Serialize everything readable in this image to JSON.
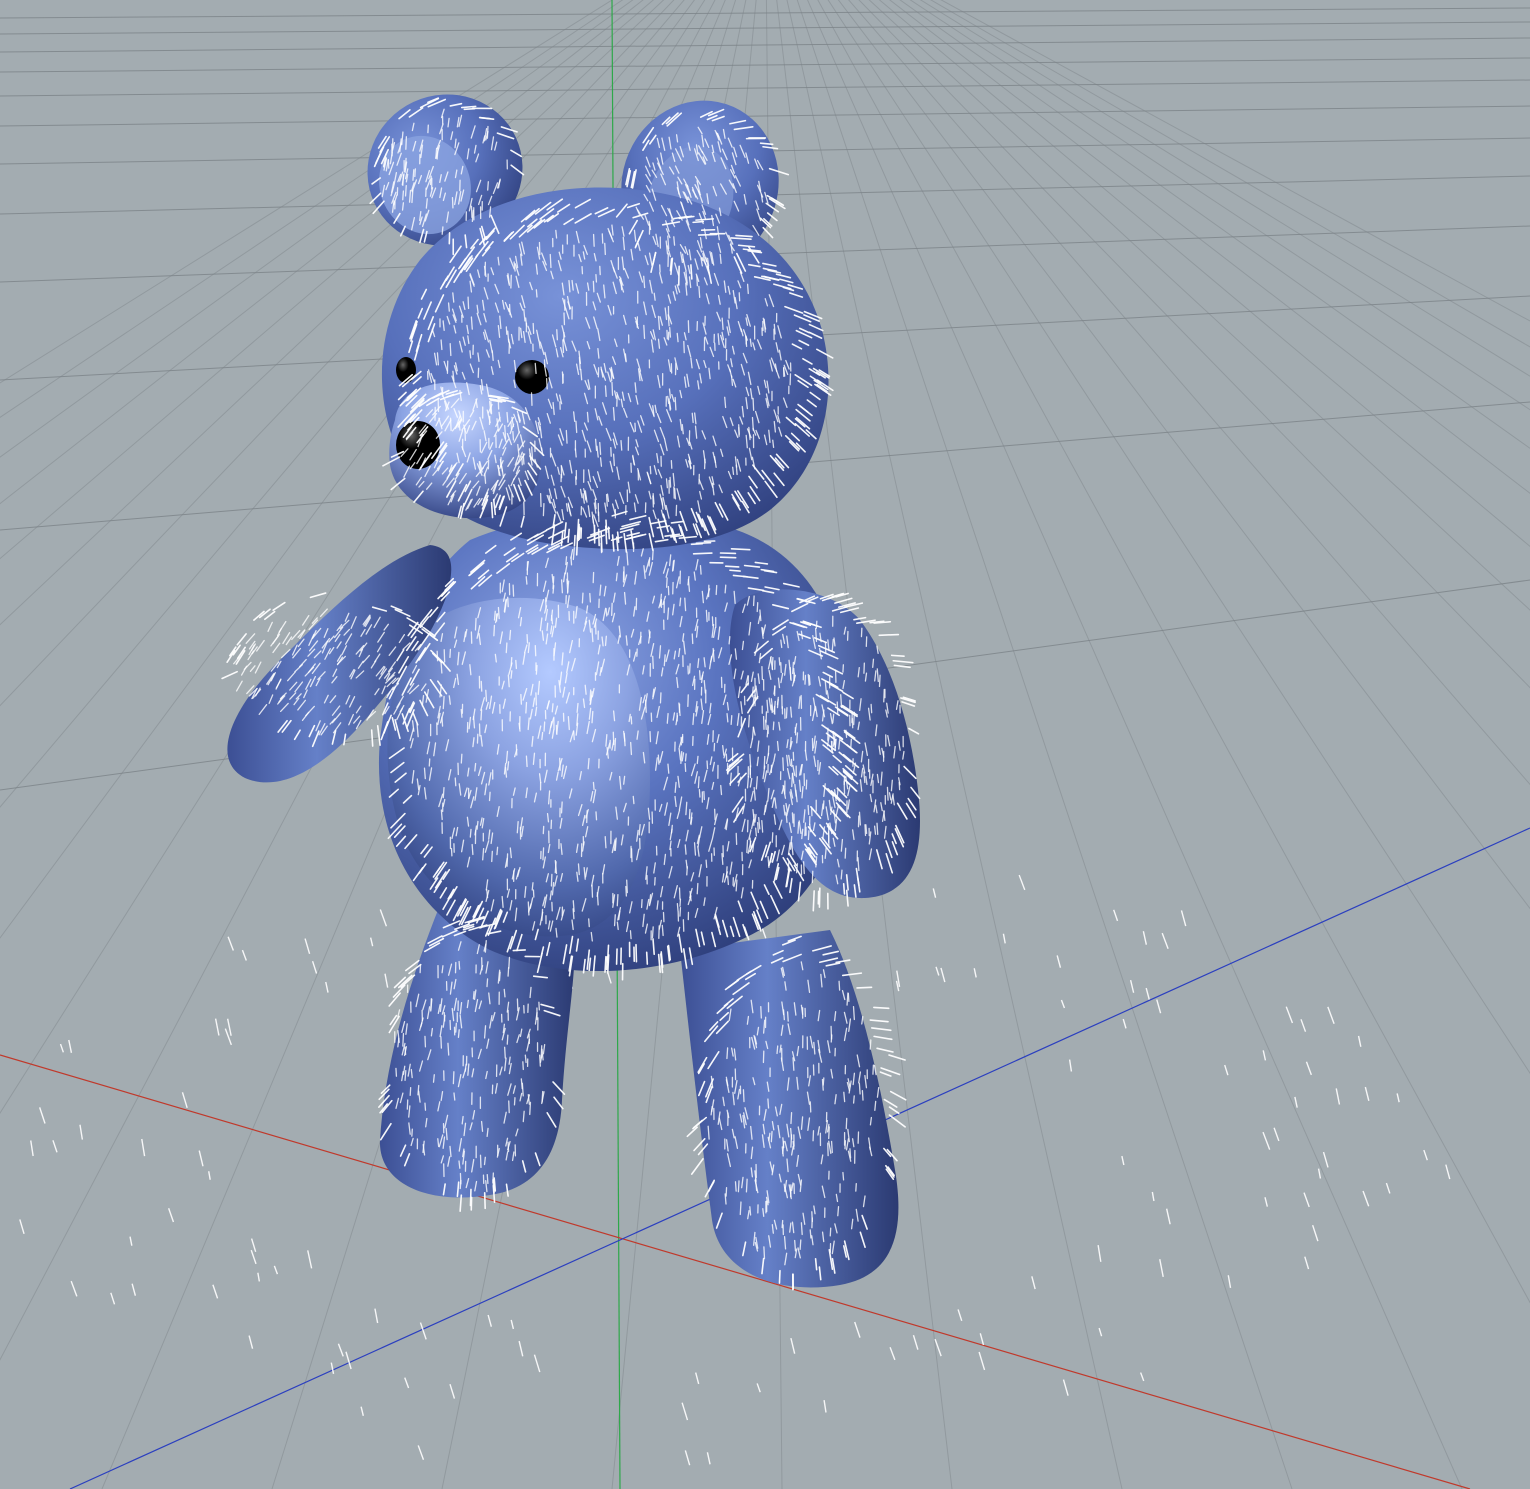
{
  "viewport": {
    "background_color": "#a3acb1",
    "grid_line_color": "#7c8388",
    "axis_colors": {
      "x": "#c0392b",
      "y": "#2ea84a",
      "z": "#2b3fbf"
    }
  },
  "model": {
    "name": "teddy-bear",
    "base_color": "#5a74c0",
    "highlight_color": "#9fb8f2",
    "shadow_color": "#2a3a72",
    "hair_guide_color": "#ffffff",
    "eye_color": "#000000"
  }
}
